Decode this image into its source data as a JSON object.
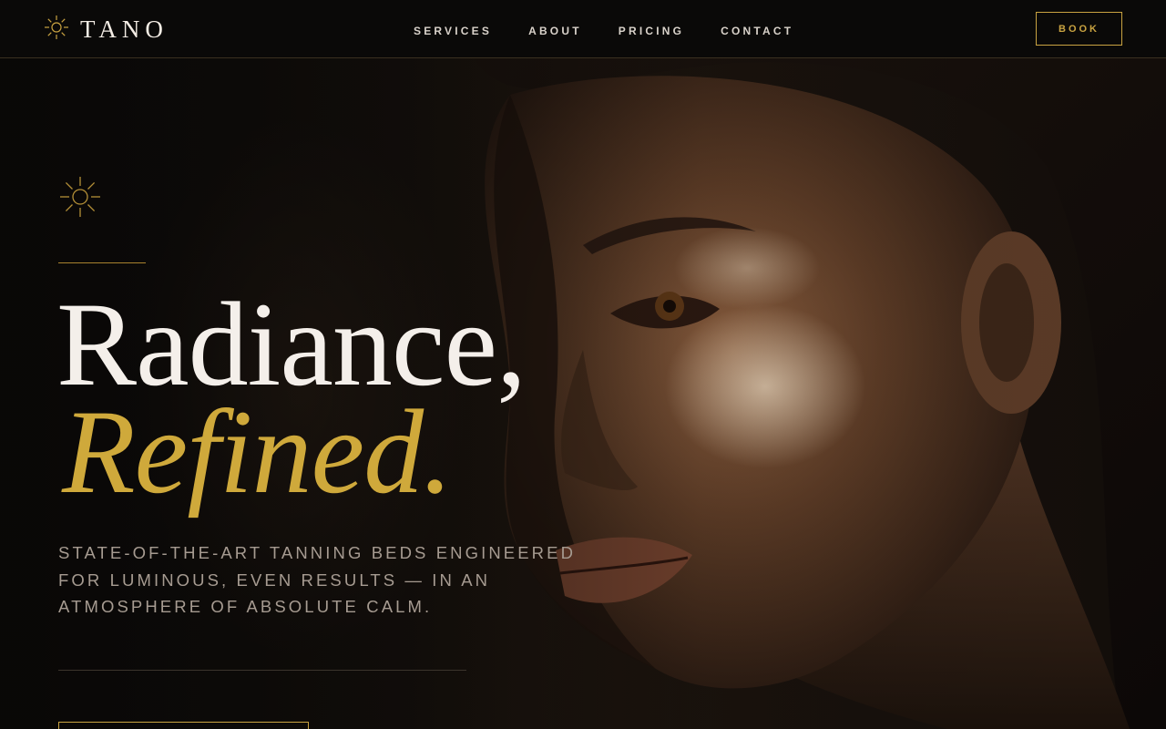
{
  "brand": {
    "name": "TANO",
    "logo_icon": "sun-icon"
  },
  "nav": {
    "items": [
      {
        "label": "SERVICES"
      },
      {
        "label": "ABOUT"
      },
      {
        "label": "PRICING"
      },
      {
        "label": "CONTACT"
      }
    ],
    "book_label": "BOOK"
  },
  "hero": {
    "icon": "sun-icon",
    "headline_line1": "Radiance,",
    "headline_line2": "Refined.",
    "subcopy": "State-of-the-art tanning beds engineered for luminous, even results — in an atmosphere of absolute calm.",
    "image_alt": "Close-up portrait of a woman with glowing skin"
  },
  "colors": {
    "background": "#0a0908",
    "accent_gold": "#c9a341",
    "headline_light": "#f4efea",
    "subcopy": "#a69b91"
  }
}
